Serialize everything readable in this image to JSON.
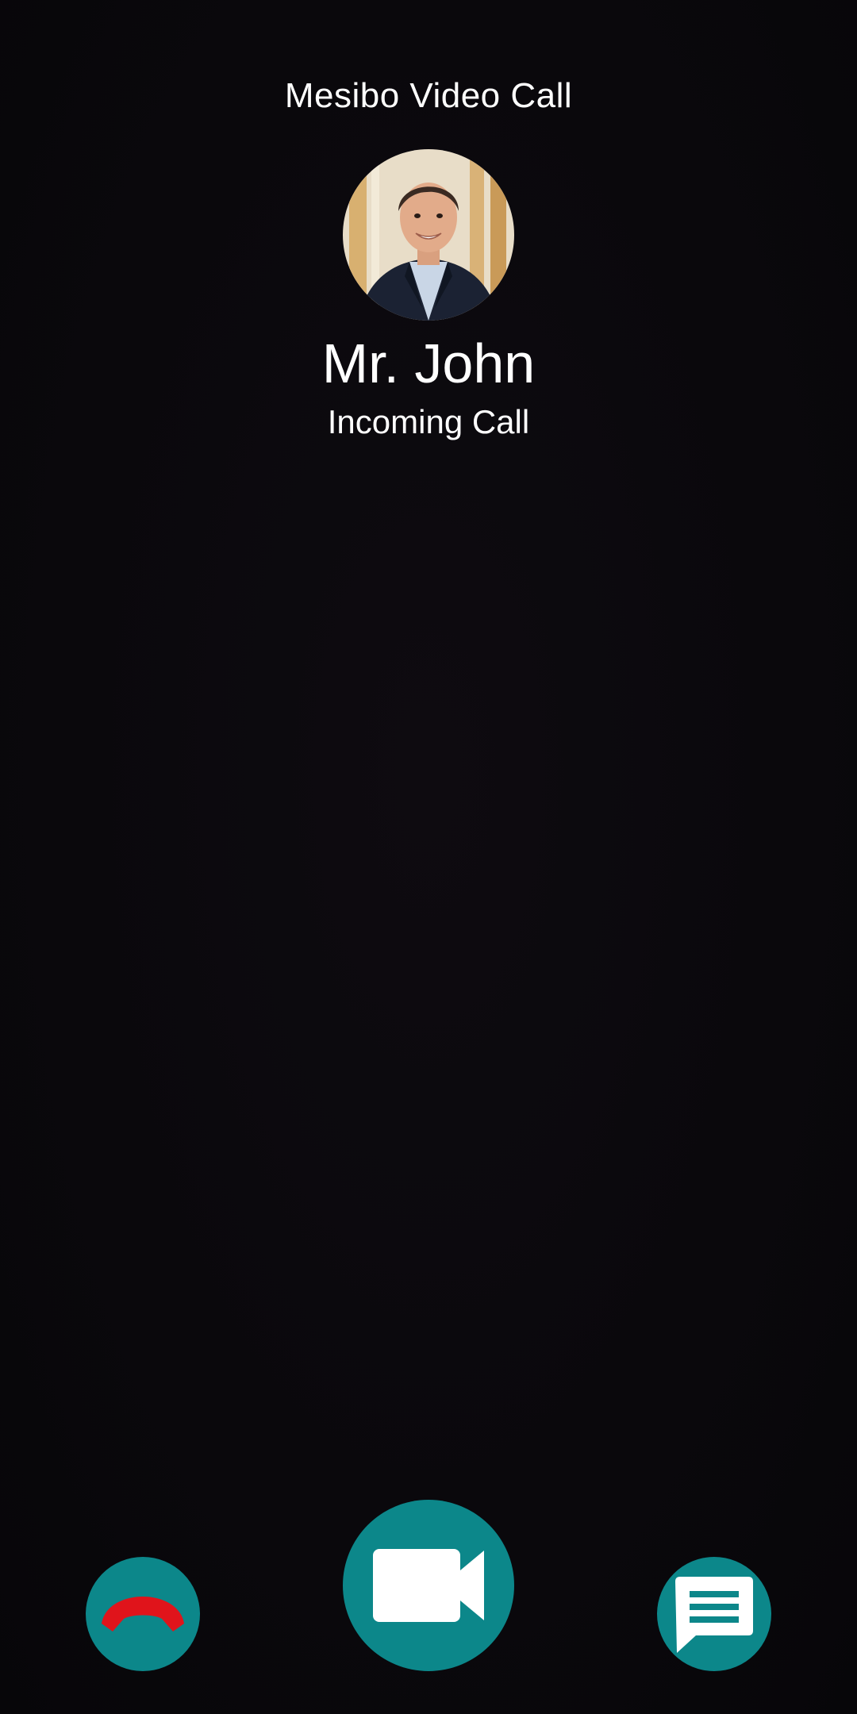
{
  "header": {
    "app_title": "Mesibo Video Call"
  },
  "caller": {
    "name": "Mr. John",
    "status": "Incoming Call",
    "avatar_icon": "caller-photo"
  },
  "actions": {
    "decline": {
      "icon": "end-call-icon",
      "icon_color": "#e0141b"
    },
    "accept_video": {
      "icon": "video-camera-icon"
    },
    "message": {
      "icon": "chat-message-icon"
    }
  },
  "colors": {
    "background": "#0b090d",
    "button_accent": "#0c878a",
    "decline_red": "#e0141b",
    "text": "#ffffff"
  }
}
